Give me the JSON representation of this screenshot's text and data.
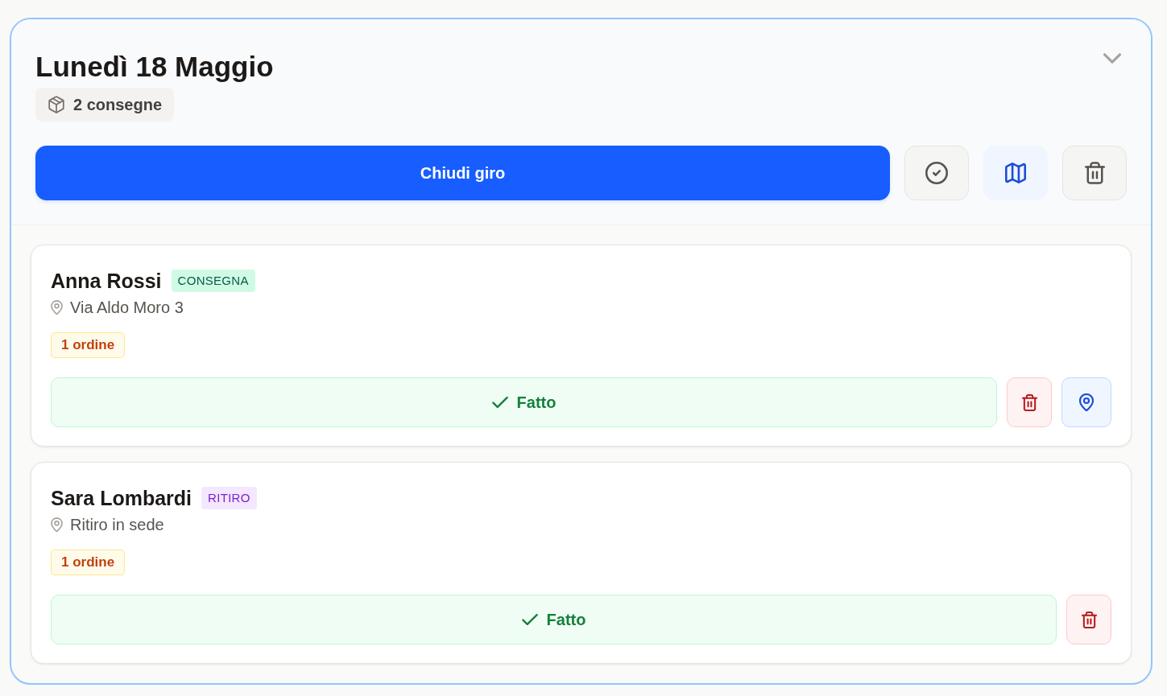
{
  "day": {
    "title": "Lunedì 18 Maggio",
    "count": "2 consegne",
    "close_button": "Chiudi giro"
  },
  "stops": [
    {
      "name": "Anna Rossi",
      "type": {
        "label": "CONSEGNA",
        "kind": "delivery"
      },
      "address": "Via Aldo Moro 3",
      "orders": "1 ordine",
      "done_button": "Fatto",
      "navigate": true
    },
    {
      "name": "Sara Lombardi",
      "type": {
        "label": "RITIRO",
        "kind": "pickup"
      },
      "address": "Ritiro in sede",
      "orders": "1 ordine",
      "done_button": "Fatto",
      "navigate": false
    }
  ]
}
